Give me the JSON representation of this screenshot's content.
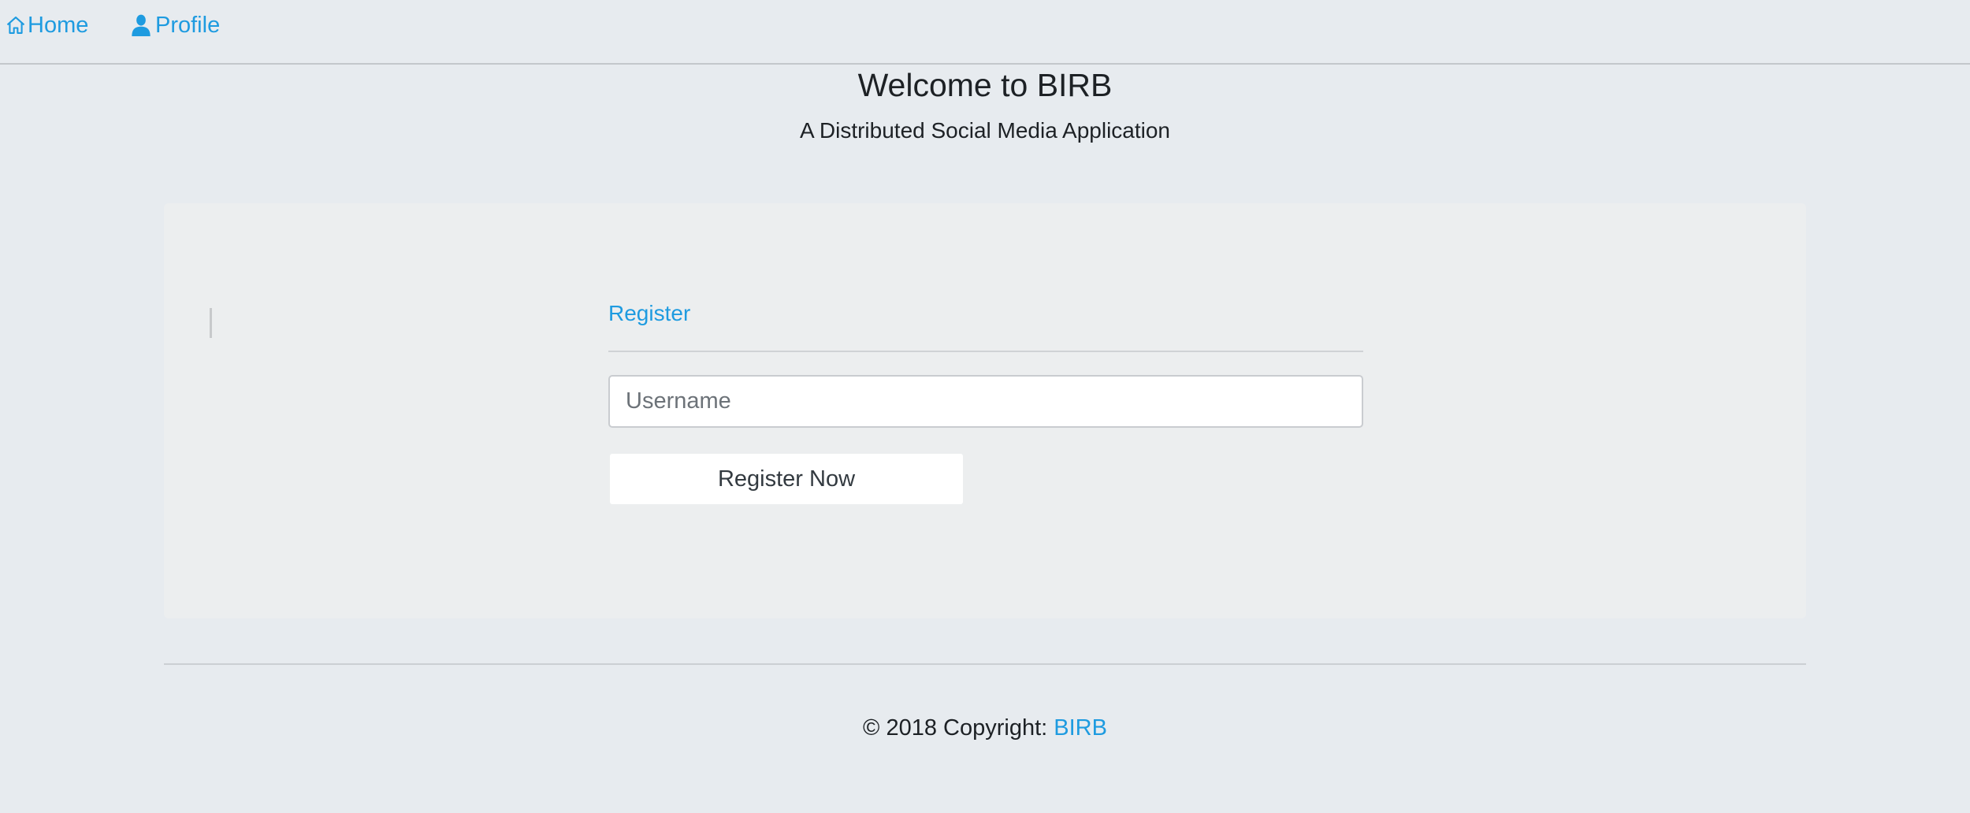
{
  "nav": {
    "home_label": "Home",
    "profile_label": "Profile",
    "home_icon": "home-icon",
    "profile_icon": "person-icon"
  },
  "header": {
    "title": "Welcome to BIRB",
    "subtitle": "A Distributed Social Media Application"
  },
  "register": {
    "heading": "Register",
    "username_placeholder": "Username",
    "username_value": "",
    "button_label": "Register Now"
  },
  "footer": {
    "copyright_text": "© 2018 Copyright: ",
    "link_label": "BIRB"
  },
  "colors": {
    "accent": "#1e9be0",
    "background": "#e7ebef",
    "card": "#eceeef"
  }
}
